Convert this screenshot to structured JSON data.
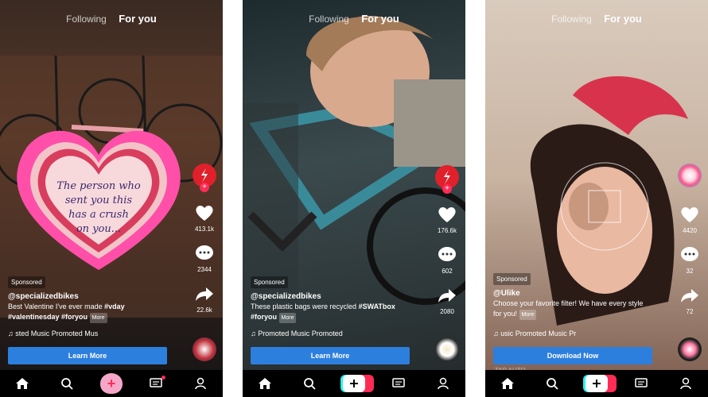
{
  "screens": [
    {
      "tabs": {
        "following": "Following",
        "foryou": "For you"
      },
      "likes": "413.1k",
      "comments": "2344",
      "shares": "22.6k",
      "sponsored": "Sponsored",
      "handle": "@specializedbikes",
      "caption_line1": "Best Valentine I've ever made ",
      "caption_tag1": "#vday",
      "caption_line2": "#valentinesday #foryou",
      "more": "More",
      "music": "♫  sted Music   Promoted Mus",
      "cta": "Learn More",
      "heart_text": [
        "The person who",
        "sent you this",
        "has a crush",
        "on you..."
      ]
    },
    {
      "tabs": {
        "following": "Following",
        "foryou": "For you"
      },
      "likes": "176.6k",
      "comments": "602",
      "shares": "2080",
      "sponsored": "Sponsored",
      "handle": "@specializedbikes",
      "caption_line1": "These plastic bags were recycled ",
      "caption_tag1": "#SWATbox",
      "caption_line2": "#foryou",
      "more": "More",
      "music": "♫  Promoted Music   Promoted",
      "cta": "Learn More"
    },
    {
      "tabs": {
        "following": "Following",
        "foryou": "For you"
      },
      "likes": "4420",
      "comments": "32",
      "shares": "72",
      "sponsored": "Sponsored",
      "handle": "@Ulike",
      "caption_line1": "Choose your favorite filter! We have every style",
      "caption_tag1": "",
      "caption_line2": "for you!",
      "more": "More",
      "music": "♫  usic   Promoted Music   Pr",
      "cta": "Download Now",
      "overlay_text": "TAP AUTO"
    }
  ],
  "colors": {
    "cta": "#2d7fde",
    "accent": "#fe2c55",
    "cyan": "#25f4ee"
  }
}
